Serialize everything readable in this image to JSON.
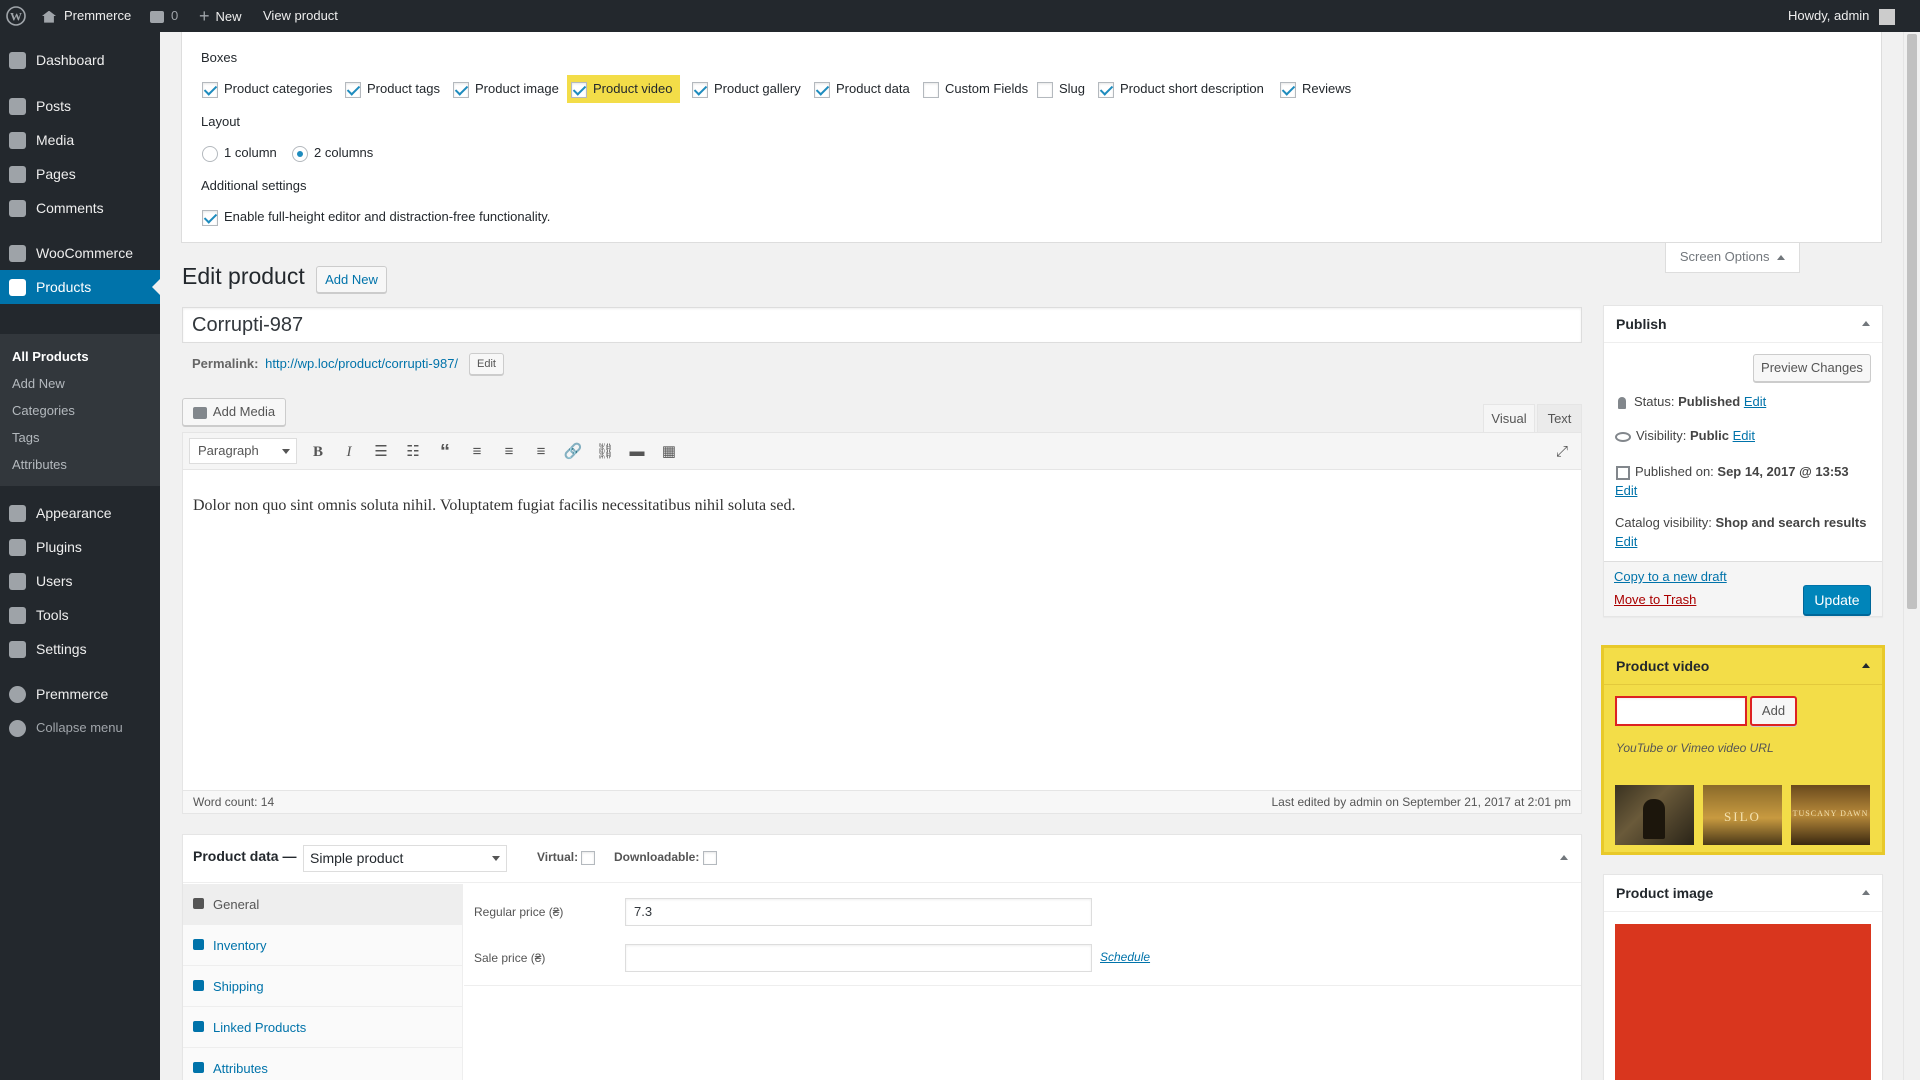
{
  "adminbar": {
    "site_name": "Premmerce",
    "comments_count": "0",
    "new_label": "New",
    "view_product_label": "View product",
    "howdy": "Howdy, admin"
  },
  "sidebar": {
    "items": [
      {
        "label": "Dashboard",
        "icon": "dashboard-icon"
      },
      {
        "label": "Posts",
        "icon": "pin-icon"
      },
      {
        "label": "Media",
        "icon": "media-icon"
      },
      {
        "label": "Pages",
        "icon": "pages-icon"
      },
      {
        "label": "Comments",
        "icon": "comments-icon"
      },
      {
        "label": "WooCommerce",
        "icon": "woocommerce-icon"
      },
      {
        "label": "Products",
        "icon": "products-icon"
      },
      {
        "label": "Appearance",
        "icon": "appearance-icon"
      },
      {
        "label": "Plugins",
        "icon": "plugins-icon"
      },
      {
        "label": "Users",
        "icon": "users-icon"
      },
      {
        "label": "Tools",
        "icon": "tools-icon"
      },
      {
        "label": "Settings",
        "icon": "settings-icon"
      },
      {
        "label": "Premmerce",
        "icon": "gear-icon"
      },
      {
        "label": "Collapse menu",
        "icon": "collapse-icon"
      }
    ],
    "submenu": [
      "All Products",
      "Add New",
      "Categories",
      "Tags",
      "Attributes"
    ]
  },
  "screen_options": {
    "boxes_heading": "Boxes",
    "boxes": [
      {
        "label": "Product categories",
        "checked": true
      },
      {
        "label": "Product tags",
        "checked": true
      },
      {
        "label": "Product image",
        "checked": true
      },
      {
        "label": "Product video",
        "checked": true
      },
      {
        "label": "Product gallery",
        "checked": true
      },
      {
        "label": "Product data",
        "checked": true
      },
      {
        "label": "Custom Fields",
        "checked": false
      },
      {
        "label": "Slug",
        "checked": false
      },
      {
        "label": "Product short description",
        "checked": true
      },
      {
        "label": "Reviews",
        "checked": true
      }
    ],
    "layout_heading": "Layout",
    "layout_options": [
      {
        "label": "1 column",
        "checked": false
      },
      {
        "label": "2 columns",
        "checked": true
      }
    ],
    "additional_heading": "Additional settings",
    "additional_option": "Enable full-height editor and distraction-free functionality.",
    "tab_label": "Screen Options"
  },
  "page": {
    "title": "Edit product",
    "add_new": "Add New",
    "product_title": "Corrupti-987",
    "permalink_label": "Permalink:",
    "permalink_url": "http://wp.loc/product/corrupti-987/",
    "permalink_edit": "Edit"
  },
  "editor": {
    "add_media": "Add Media",
    "tab_visual": "Visual",
    "tab_text": "Text",
    "format_select": "Paragraph",
    "content": "Dolor non quo sint omnis soluta nihil. Voluptatem fugiat facilis necessitatibus nihil soluta sed.",
    "word_count": "Word count: 14",
    "last_edited": "Last edited by admin on September 21, 2017 at 2:01 pm"
  },
  "product_data": {
    "title": "Product data —",
    "type_select": "Simple product",
    "virtual_label": "Virtual:",
    "downloadable_label": "Downloadable:",
    "tabs": [
      "General",
      "Inventory",
      "Shipping",
      "Linked Products",
      "Attributes"
    ],
    "regular_price_label": "Regular price (₴)",
    "regular_price_value": "7.3",
    "sale_price_label": "Sale price (₴)",
    "sale_price_value": "",
    "schedule_link": "Schedule"
  },
  "publish": {
    "title": "Publish",
    "preview_button": "Preview Changes",
    "status_label": "Status:",
    "status_value": "Published",
    "visibility_label": "Visibility:",
    "visibility_value": "Public",
    "published_label": "Published on:",
    "published_value": "Sep 14, 2017 @ 13:53",
    "catalog_label": "Catalog visibility:",
    "catalog_value": "Shop and search results",
    "edit": "Edit",
    "copy_draft": "Copy to a new draft",
    "trash": "Move to Trash",
    "update_button": "Update"
  },
  "product_video": {
    "title": "Product video",
    "input_value": "",
    "add_button": "Add",
    "hint": "YouTube or Vimeo video URL",
    "thumb_texts": [
      "SILO",
      "TUSCANY DAWN"
    ]
  },
  "product_image": {
    "title": "Product image"
  },
  "colors": {
    "accent": "#0073aa",
    "sidebar_bg": "#23282d",
    "highlight": "#f3dd48",
    "highlight_border": "#e8c92a",
    "outline_red": "#dd2222",
    "image_red": "#d9361e"
  }
}
